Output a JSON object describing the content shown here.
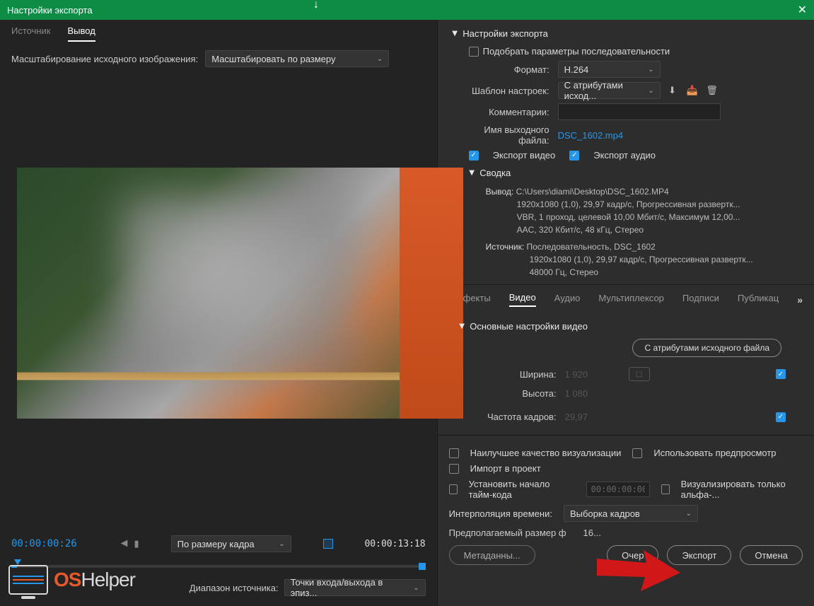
{
  "window": {
    "title": "Настройки экспорта"
  },
  "left": {
    "tabs": {
      "source": "Источник",
      "output": "Вывод"
    },
    "scale_label": "Масштабирование исходного изображения:",
    "scale_value": "Масштабировать по размеру",
    "time_current": "00:00:00:26",
    "fit_label": "По размеру кадра",
    "time_total": "00:00:13:18",
    "range_label": "Диапазон источника:",
    "range_value": "Точки входа/выхода в эпиз..."
  },
  "export": {
    "section_title": "Настройки экспорта",
    "match_seq": "Подобрать параметры последовательности",
    "format_label": "Формат:",
    "format_value": "H.264",
    "preset_label": "Шаблон настроек:",
    "preset_value": "С атрибутами исход...",
    "comments_label": "Комментарии:",
    "outname_label": "Имя выходного файла:",
    "outname_value": "DSC_1602.mp4",
    "export_video": "Экспорт видео",
    "export_audio": "Экспорт аудио",
    "summary_title": "Сводка",
    "summary_output_label": "Вывод:",
    "summary_output_l1": "C:\\Users\\diami\\Desktop\\DSC_1602.MP4",
    "summary_output_l2": "1920x1080 (1,0), 29,97 кадр/с, Прогрессивная развертк...",
    "summary_output_l3": "VBR, 1 проход, целевой 10,00 Мбит/с, Максимум 12,00...",
    "summary_output_l4": "AAC, 320 Кбит/с, 48 кГц, Стерео",
    "summary_source_label": "Источник:",
    "summary_source_l1": "Последовательность, DSC_1602",
    "summary_source_l2": "1920x1080 (1,0), 29,97 кадр/с, Прогрессивная развертк...",
    "summary_source_l3": "48000 Гц, Стерео"
  },
  "subtabs": {
    "effects": "Эффекты",
    "video": "Видео",
    "audio": "Аудио",
    "mux": "Мультиплексор",
    "captions": "Подписи",
    "publish": "Публикац"
  },
  "video": {
    "section_title": "Основные настройки видео",
    "attr_btn": "С атрибутами исходного файла",
    "width_label": "Ширина:",
    "width_val": "1 920",
    "height_label": "Высота:",
    "height_val": "1 080",
    "fps_label": "Частота кадров:",
    "fps_val": "29,97"
  },
  "bottom": {
    "best_quality": "Наилучшее качество визуализации",
    "use_preview": "Использовать предпросмотр",
    "import_project": "Импорт в проект",
    "set_timecode": "Установить начало тайм-кода",
    "timecode_val": "00:00:00:00",
    "alpha_only": "Визуализировать только альфа-...",
    "interp_label": "Интерполяция времени:",
    "interp_value": "Выборка кадров",
    "est_label": "Предполагаемый размер ф",
    "est_val": "16...",
    "btn_metadata": "Метаданны...",
    "btn_queue": "Очер",
    "btn_export": "Экспорт",
    "btn_cancel": "Отмена"
  },
  "logo": {
    "os": "OS",
    "helper": "Helper"
  }
}
